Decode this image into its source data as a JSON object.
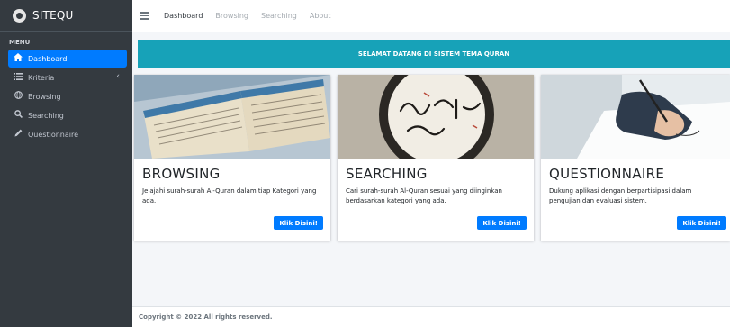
{
  "brand": {
    "name": "SITEQU"
  },
  "sidebar": {
    "header": "MENU",
    "items": [
      {
        "label": "Dashboard",
        "icon": "home-icon"
      },
      {
        "label": "Kriteria",
        "icon": "list-icon",
        "caret": "‹"
      },
      {
        "label": "Browsing",
        "icon": "globe-icon"
      },
      {
        "label": "Searching",
        "icon": "search-icon"
      },
      {
        "label": "Questionnaire",
        "icon": "pencil-icon"
      }
    ]
  },
  "topnav": {
    "links": [
      "Dashboard",
      "Browsing",
      "Searching",
      "About"
    ]
  },
  "banner": {
    "text": "SELAMAT DATANG DI SISTEM TEMA QURAN"
  },
  "cards": [
    {
      "title": "BROWSING",
      "text": "Jelajahi surah-surah Al-Quran dalam tiap Kategori yang ada.",
      "button": "Klik Disini!"
    },
    {
      "title": "SEARCHING",
      "text": "Cari surah-surah Al-Quran sesuai yang diinginkan berdasarkan kategori yang ada.",
      "button": "Klik Disini!"
    },
    {
      "title": "QUESTIONNAIRE",
      "text": "Dukung aplikasi dengan berpartisipasi dalam pengujian dan evaluasi sistem.",
      "button": "Klik Disini!"
    }
  ],
  "footer": {
    "text": "Copyright © 2022 All rights reserved."
  },
  "colors": {
    "sidebar": "#343a40",
    "active": "#007bff",
    "banner": "#17a2b8"
  }
}
